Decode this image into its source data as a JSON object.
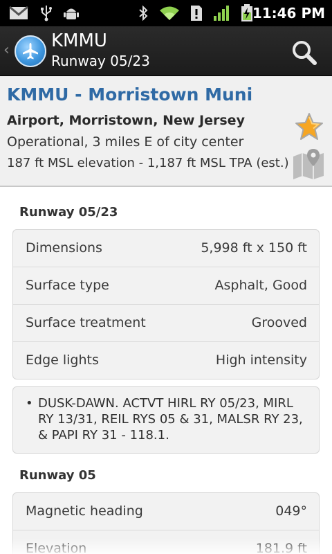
{
  "status_bar": {
    "time": "11:46 PM",
    "icons": [
      "gmail-icon",
      "usb-icon",
      "android-debug-icon",
      "bluetooth-icon",
      "wifi-icon",
      "alert-icon",
      "signal-icon",
      "battery-charging-icon"
    ]
  },
  "action_bar": {
    "title": "KMMU",
    "subtitle": "Runway 05/23",
    "search_icon": "search-icon"
  },
  "airport": {
    "title": "KMMU - Morristown Muni",
    "type_location": "Airport, Morristown, New Jersey",
    "status": "Operational, 3 miles E of city center",
    "elevation": "187 ft MSL elevation - 1,187 ft MSL TPA  (est.)",
    "favorite_icon": "star-icon",
    "map_icon": "map-icon"
  },
  "sections": [
    {
      "title": "Runway 05/23",
      "rows": [
        {
          "label": "Dimensions",
          "value": "5,998 ft x 150 ft"
        },
        {
          "label": "Surface type",
          "value": "Asphalt, Good"
        },
        {
          "label": "Surface treatment",
          "value": "Grooved"
        },
        {
          "label": "Edge lights",
          "value": "High intensity"
        }
      ],
      "remarks": [
        "DUSK-DAWN. ACTVT HIRL RY 05/23, MIRL RY 13/31, REIL RYS 05 & 31, MALSR RY 23, &  PAPI RY 31 - 118.1."
      ]
    },
    {
      "title": "Runway 05",
      "rows": [
        {
          "label": "Magnetic heading",
          "value": "049°"
        },
        {
          "label": "Elevation",
          "value": "181.9 ft"
        }
      ]
    }
  ],
  "colors": {
    "title_blue": "#2f6aa5",
    "status_bar": "#000000",
    "action_bar": "#1c1c1c",
    "star": "#f6a623"
  }
}
